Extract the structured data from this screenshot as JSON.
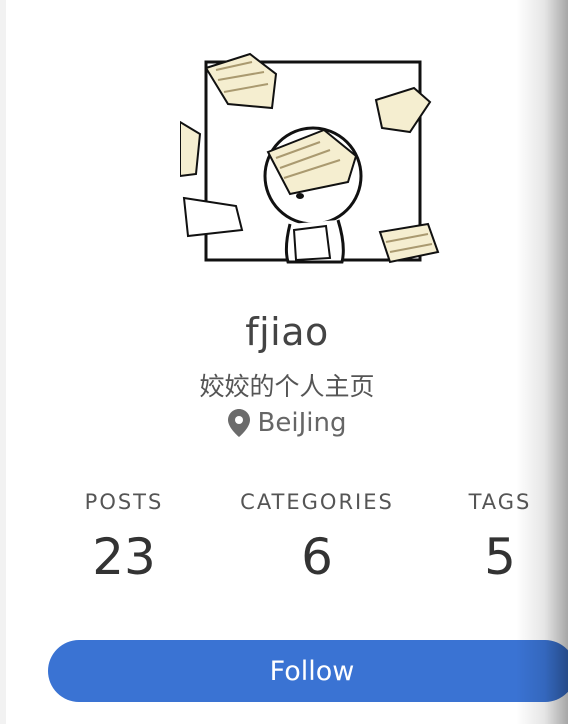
{
  "profile": {
    "name": "fjiao",
    "description": "姣姣的个人主页",
    "location": "BeiJing",
    "location_icon": "map-marker-icon",
    "avatar_icon": "cartoon-avatar-icon"
  },
  "stats": [
    {
      "label": "POSTS",
      "value": "23"
    },
    {
      "label": "CATEGORIES",
      "value": "6"
    },
    {
      "label": "TAGS",
      "value": "5"
    }
  ],
  "follow": {
    "label": "Follow"
  },
  "colors": {
    "accent": "#3a73d3",
    "text": "#444444"
  }
}
